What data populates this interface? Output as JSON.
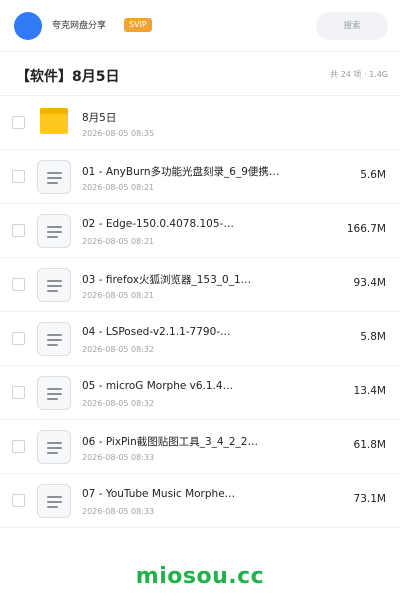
{
  "header": {
    "brand": "夸克网盘分享",
    "badge": "SVIP",
    "search_label": "搜索",
    "avatar_color": "#2f7cf6"
  },
  "folder": {
    "title": "【软件】8月5日",
    "summary": "共 24 项 · 1.4G"
  },
  "files": [
    {
      "type": "folder",
      "name": "8月5日",
      "date": "2026-08-05 08:35",
      "size": ""
    },
    {
      "type": "file",
      "name": "01 - AnyBurn多功能光盘刻录_6_9便携…",
      "date": "2026-08-05 08:21",
      "size": "5.6M"
    },
    {
      "type": "file",
      "name": "02 - Edge-150.0.4078.105-…",
      "date": "2026-08-05 08:21",
      "size": "166.7M"
    },
    {
      "type": "file",
      "name": "03 - firefox火狐浏览器_153_0_1…",
      "date": "2026-08-05 08:21",
      "size": "93.4M"
    },
    {
      "type": "file",
      "name": "04 - LSPosed-v2.1.1-7790-…",
      "date": "2026-08-05 08:32",
      "size": "5.8M"
    },
    {
      "type": "file",
      "name": "05 - microG Morphe v6.1.4…",
      "date": "2026-08-05 08:32",
      "size": "13.4M"
    },
    {
      "type": "file",
      "name": "06 - PixPin截图贴图工具_3_4_2_2…",
      "date": "2026-08-05 08:33",
      "size": "61.8M"
    },
    {
      "type": "file",
      "name": "07 - YouTube Music Morphe…",
      "date": "2026-08-05 08:33",
      "size": "73.1M"
    }
  ],
  "watermark": "miosou.cc"
}
